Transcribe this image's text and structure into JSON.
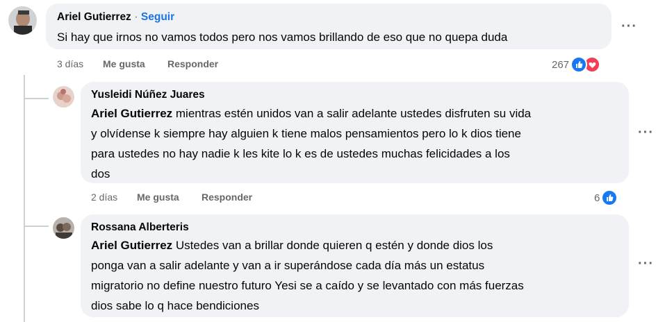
{
  "comments": [
    {
      "author": "Ariel Gutierrez",
      "follow_label": "Seguir",
      "separator": "·",
      "text": "Si hay que irnos no vamos todos pero nos vamos brillando de eso que no quepa duda",
      "time": "3 días",
      "like_label": "Me gusta",
      "reply_label": "Responder",
      "reaction_count": "267",
      "reactions": [
        "like-icon",
        "love-icon"
      ]
    },
    {
      "author": "Yusleidi Núñez Juares",
      "mention": "Ariel Gutierrez",
      "text_lines": [
        " mientras estén unidos van a salir adelante ustedes disfruten su vida",
        "y olvídense k siempre hay alguien k tiene malos pensamientos pero lo k dios tiene",
        "para ustedes no hay nadie k les kite lo k es de ustedes muchas felicidades a los",
        "dos"
      ],
      "time": "2 días",
      "like_label": "Me gusta",
      "reply_label": "Responder",
      "reaction_count": "6",
      "reactions": [
        "like-icon"
      ]
    },
    {
      "author": "Rossana Alberteris",
      "mention": "Ariel Gutierrez",
      "text_lines": [
        " Ustedes van a brillar donde quieren q estén y donde dios los",
        "ponga van a salir adelante y van a ir superándose cada día más un estatus",
        "migratorio no define nuestro futuro Yesi se a caído y se levantado con más fuerzas",
        "dios sabe lo q hace bendiciones"
      ]
    }
  ],
  "more_label": "···",
  "colors": {
    "link": "#1b74e4",
    "bubble": "#f0f2f5",
    "like": "#1877f2",
    "love": "#f33e58",
    "meta": "#65676b"
  }
}
